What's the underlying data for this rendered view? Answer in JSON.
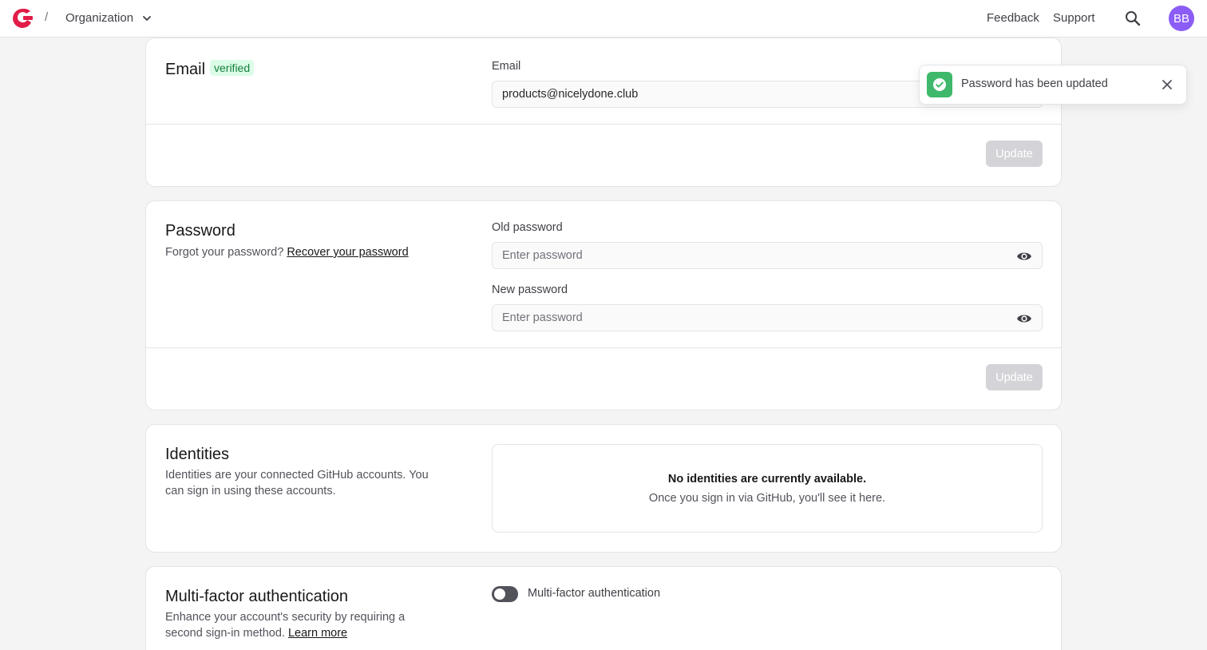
{
  "header": {
    "separator": "/",
    "org_label": "Organization",
    "feedback": "Feedback",
    "support": "Support",
    "avatar_initials": "BB",
    "brand_color": "#e11d48",
    "avatar_color": "#8b5cf6"
  },
  "email_section": {
    "title": "Email",
    "badge": "verified",
    "field_label": "Email",
    "value": "products@nicelydone.club",
    "button": "Update"
  },
  "password_section": {
    "title": "Password",
    "forgot_text": "Forgot your password?",
    "recover_link": "Recover your password",
    "old_label": "Old password",
    "old_placeholder": "Enter password",
    "new_label": "New password",
    "new_placeholder": "Enter password",
    "button": "Update"
  },
  "identities_section": {
    "title": "Identities",
    "description": "Identities are your connected GitHub accounts. You can sign in using these accounts.",
    "empty_title": "No identities are currently available.",
    "empty_sub": "Once you sign in via GitHub, you'll see it here."
  },
  "mfa_section": {
    "title": "Multi-factor authentication",
    "description": "Enhance your account's security by requiring a second sign-in method.",
    "learn_more": "Learn more",
    "toggle_label": "Multi-factor authentication",
    "enabled": false
  },
  "toast": {
    "message": "Password has been updated",
    "success_color": "#3fb86b"
  }
}
